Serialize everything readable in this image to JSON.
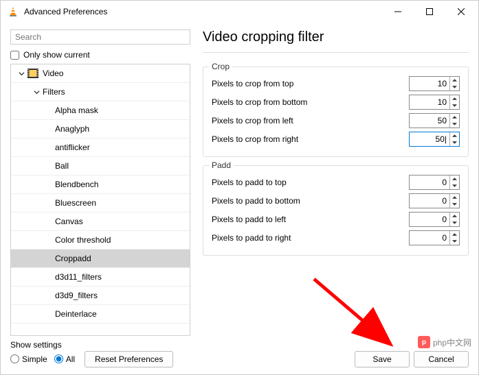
{
  "window": {
    "title": "Advanced Preferences"
  },
  "search": {
    "placeholder": "Search"
  },
  "only_show_current": {
    "label": "Only show current",
    "checked": false
  },
  "tree": {
    "video_label": "Video",
    "filters_label": "Filters",
    "items": [
      {
        "label": "Alpha mask",
        "selected": false
      },
      {
        "label": "Anaglyph",
        "selected": false
      },
      {
        "label": "antiflicker",
        "selected": false
      },
      {
        "label": "Ball",
        "selected": false
      },
      {
        "label": "Blendbench",
        "selected": false
      },
      {
        "label": "Bluescreen",
        "selected": false
      },
      {
        "label": "Canvas",
        "selected": false
      },
      {
        "label": "Color threshold",
        "selected": false
      },
      {
        "label": "Croppadd",
        "selected": true
      },
      {
        "label": "d3d11_filters",
        "selected": false
      },
      {
        "label": "d3d9_filters",
        "selected": false
      },
      {
        "label": "Deinterlace",
        "selected": false
      }
    ]
  },
  "page": {
    "title": "Video cropping filter",
    "groups": [
      {
        "title": "Crop",
        "fields": [
          {
            "label": "Pixels to crop from top",
            "value": "10",
            "highlight": false
          },
          {
            "label": "Pixels to crop from bottom",
            "value": "10",
            "highlight": false
          },
          {
            "label": "Pixels to crop from left",
            "value": "50",
            "highlight": false
          },
          {
            "label": "Pixels to crop from right",
            "value": "50",
            "highlight": true
          }
        ]
      },
      {
        "title": "Padd",
        "fields": [
          {
            "label": "Pixels to padd to top",
            "value": "0",
            "highlight": false
          },
          {
            "label": "Pixels to padd to bottom",
            "value": "0",
            "highlight": false
          },
          {
            "label": "Pixels to padd to left",
            "value": "0",
            "highlight": false
          },
          {
            "label": "Pixels to padd to right",
            "value": "0",
            "highlight": false
          }
        ]
      }
    ]
  },
  "footer": {
    "show_settings_label": "Show settings",
    "simple_label": "Simple",
    "all_label": "All",
    "mode": "all",
    "reset_label": "Reset Preferences",
    "save_label": "Save",
    "cancel_label": "Cancel"
  },
  "watermark": {
    "text": "php中文网"
  }
}
